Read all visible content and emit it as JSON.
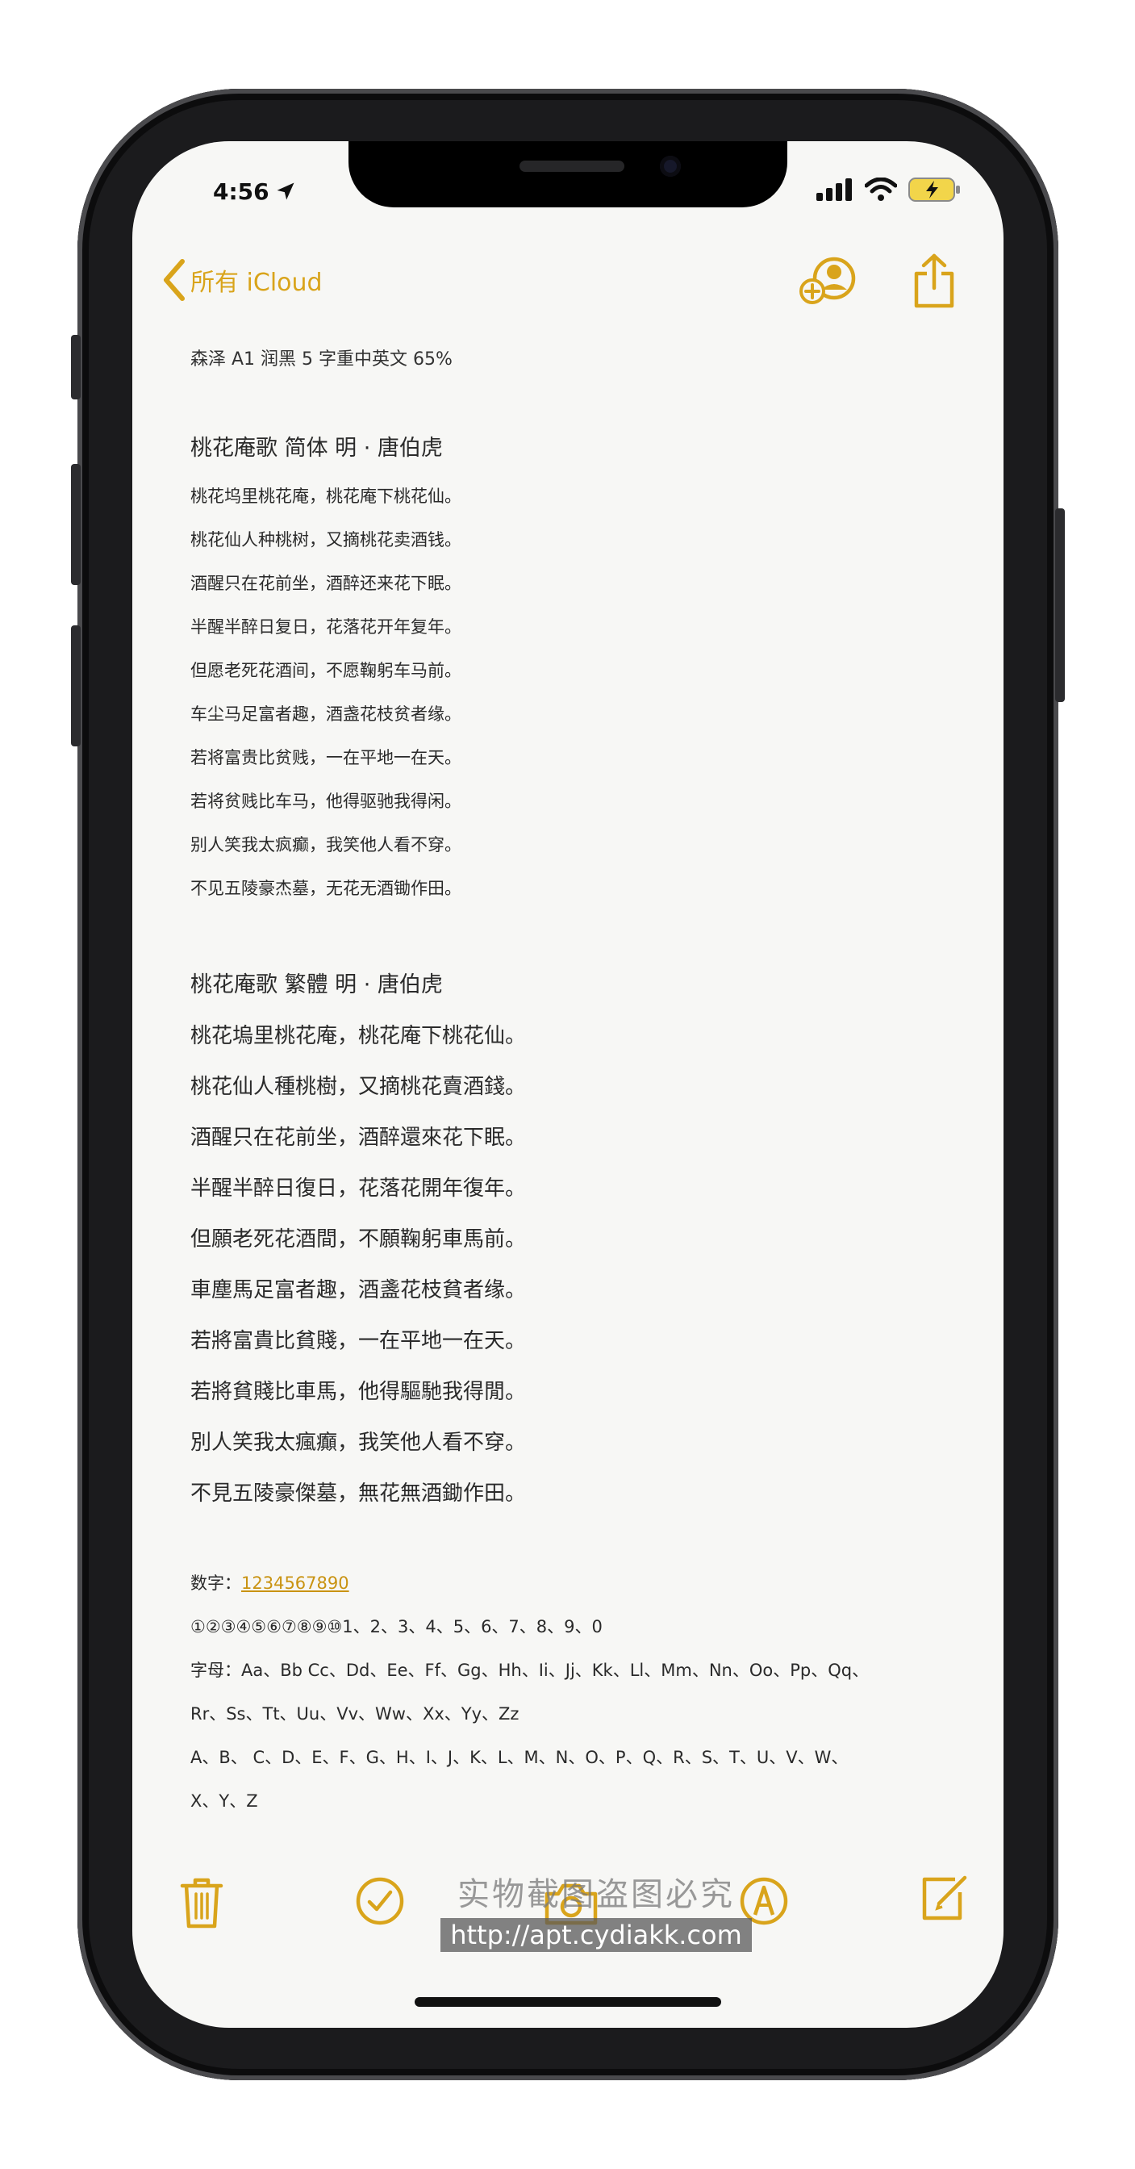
{
  "status": {
    "time": "4:56"
  },
  "nav": {
    "back_label": "所有 iCloud"
  },
  "note": {
    "header": "森泽 A1 润黑 5 字重中英文 65%",
    "simplified_title": "桃花庵歌  简体   明 · 唐伯虎",
    "simplified_lines": [
      "桃花坞里桃花庵，桃花庵下桃花仙。",
      "桃花仙人种桃树，又摘桃花卖酒钱。",
      "酒醒只在花前坐，酒醉还来花下眠。",
      "半醒半醉日复日，花落花开年复年。",
      "但愿老死花酒间，不愿鞠躬车马前。",
      "车尘马足富者趣，酒盏花枝贫者缘。",
      "若将富贵比贫贱，一在平地一在天。",
      "若将贫贱比车马，他得驱驰我得闲。",
      "别人笑我太疯癫，我笑他人看不穿。",
      "不见五陵豪杰墓，无花无酒锄作田。"
    ],
    "traditional_title": "桃花庵歌  繁體      明 · 唐伯虎",
    "traditional_lines": [
      "桃花塢里桃花庵，桃花庵下桃花仙。",
      "桃花仙人種桃樹，又摘桃花賣酒錢。",
      "酒醒只在花前坐，酒醉還來花下眠。",
      "半醒半醉日復日，花落花開年復年。",
      "但願老死花酒間，不願鞠躬車馬前。",
      "車塵馬足富者趣，酒盞花枝貧者缘。",
      "若將富貴比貧賤，一在平地一在天。",
      "若將貧賤比車馬，他得驅馳我得閒。",
      "別人笑我太瘋癲，我笑他人看不穿。",
      "不見五陵豪傑墓，無花無酒鋤作田。"
    ],
    "digits_label": "数字：",
    "digits_value": "1234567890",
    "circled_digits": "①②③④⑤⑥⑦⑧⑨⑩1、2、3、4、5、6、7、8、9、0",
    "letters_line1": "字母：Aa、Bb Cc、Dd、Ee、Ff、Gg、Hh、Ii、Jj、Kk、Ll、Mm、Nn、Oo、Pp、Qq、",
    "letters_line2": "Rr、Ss、Tt、Uu、Vv、Ww、Xx、Yy、Zz",
    "upper_line1": "A、B、 C、D、E、F、G、H、I、J、K、L、M、N、O、P、Q、R、S、T、U、V、W、",
    "upper_line2": "X、Y、Z"
  },
  "watermark": {
    "line1": "实物截图盗图必究",
    "line2": "http://apt.cydiakk.com"
  },
  "colors": {
    "accent": "#d9a41b",
    "text": "#2a2a2a",
    "background": "#f7f7f5"
  }
}
